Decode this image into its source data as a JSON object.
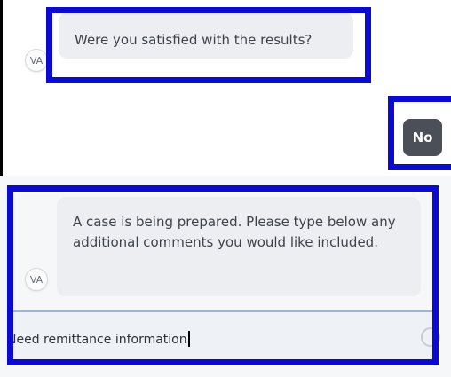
{
  "chat": {
    "messages": [
      {
        "sender": "VA",
        "text": "Were you satisfied with the results?"
      },
      {
        "sender": "user",
        "text": "No"
      },
      {
        "sender": "VA",
        "text": "A case is being prepared. Please type below any additional comments you would like included."
      }
    ]
  },
  "input": {
    "value": "Need remittance information"
  },
  "colors": {
    "highlight": "#0a0ad2",
    "bot_bubble": "#eceef1",
    "user_bubble": "#4b4f57"
  }
}
